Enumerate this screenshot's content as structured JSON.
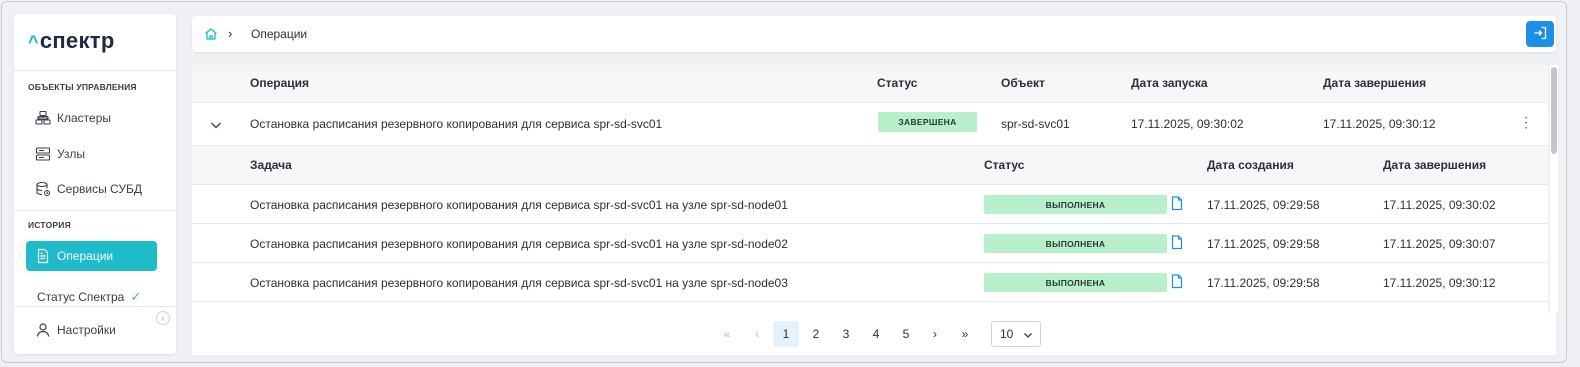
{
  "app": {
    "logo_text": "спектр",
    "logo_caret": "^"
  },
  "sidebar": {
    "section_objects": "ОБЪЕКТЫ УПРАВЛЕНИЯ",
    "section_history": "ИСТОРИЯ",
    "items": [
      {
        "label": "Кластеры",
        "icon": "cluster-icon"
      },
      {
        "label": "Узлы",
        "icon": "server-icon"
      },
      {
        "label": "Сервисы СУБД",
        "icon": "database-icon"
      },
      {
        "label": "Операции",
        "icon": "document-icon",
        "active": true
      }
    ],
    "status_label": "Статус Спектра",
    "status_ok": "✓",
    "settings_label": "Настройки",
    "collapse_glyph": "‹"
  },
  "header": {
    "breadcrumb_separator": "›",
    "breadcrumb": "Операции"
  },
  "operations": {
    "columns": {
      "operation": "Операция",
      "status": "Статус",
      "object": "Объект",
      "started": "Дата запуска",
      "finished": "Дата завершения"
    },
    "row": {
      "operation": "Остановка расписания резервного копирования для сервиса spr-sd-svc01",
      "status": "ЗАВЕРШЕНА",
      "object": "spr-sd-svc01",
      "started": "17.11.2025, 09:30:02",
      "finished": "17.11.2025, 09:30:12",
      "menu_glyph": "⋮"
    }
  },
  "tasks": {
    "columns": {
      "task": "Задача",
      "status": "Статус",
      "created": "Дата создания",
      "finished": "Дата завершения"
    },
    "rows": [
      {
        "task": "Остановка расписания резервного копирования для сервиса spr-sd-svc01 на узле spr-sd-node01",
        "status": "ВЫПОЛНЕНА",
        "created": "17.11.2025, 09:29:58",
        "finished": "17.11.2025, 09:30:02"
      },
      {
        "task": "Остановка расписания резервного копирования для сервиса spr-sd-svc01 на узле spr-sd-node02",
        "status": "ВЫПОЛНЕНА",
        "created": "17.11.2025, 09:29:58",
        "finished": "17.11.2025, 09:30:07"
      },
      {
        "task": "Остановка расписания резервного копирования для сервиса spr-sd-svc01 на узле spr-sd-node03",
        "status": "ВЫПОЛНЕНА",
        "created": "17.11.2025, 09:29:58",
        "finished": "17.11.2025, 09:30:12"
      }
    ]
  },
  "pagination": {
    "first": "«",
    "prev": "‹",
    "pages": [
      "1",
      "2",
      "3",
      "4",
      "5"
    ],
    "current": "1",
    "next": "›",
    "last": "»",
    "per_page": "10"
  },
  "colors": {
    "accent": "#1ebccb",
    "primary_button": "#1e8fe8",
    "status_badge": "#b8f0cb"
  }
}
